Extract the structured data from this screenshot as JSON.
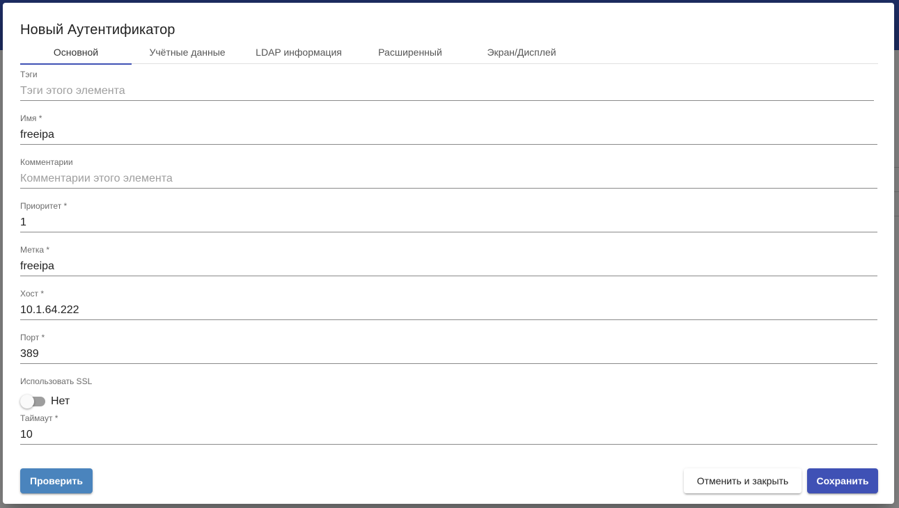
{
  "dialog": {
    "title": "Новый Аутентификатор",
    "tabs": [
      {
        "label": "Основной"
      },
      {
        "label": "Учётные данные"
      },
      {
        "label": "LDAP информация"
      },
      {
        "label": "Расширенный"
      },
      {
        "label": "Экран/Дисплей"
      }
    ],
    "active_tab": "Основной",
    "fields": {
      "tags": {
        "label": "Тэги",
        "value": "",
        "placeholder": "Тэги этого элемента"
      },
      "name": {
        "label": "Имя *",
        "value": "freeipa"
      },
      "comments": {
        "label": "Комментарии",
        "value": "",
        "placeholder": "Комментарии этого элемента"
      },
      "priority": {
        "label": "Приоритет *",
        "value": "1"
      },
      "label": {
        "label": "Метка *",
        "value": "freeipa"
      },
      "host": {
        "label": "Хост *",
        "value": "10.1.64.222"
      },
      "port": {
        "label": "Порт *",
        "value": "389"
      },
      "use_ssl": {
        "label": "Использовать SSL",
        "state_text": "Нет",
        "checked": false
      },
      "timeout": {
        "label": "Таймаут *",
        "value": "10"
      }
    },
    "buttons": {
      "test": "Проверить",
      "cancel": "Отменить и закрыть",
      "save": "Сохранить"
    }
  },
  "colors": {
    "primary": "#3f51b5",
    "test_button": "#4a84bd",
    "background_topbar": "#1f2f66"
  }
}
